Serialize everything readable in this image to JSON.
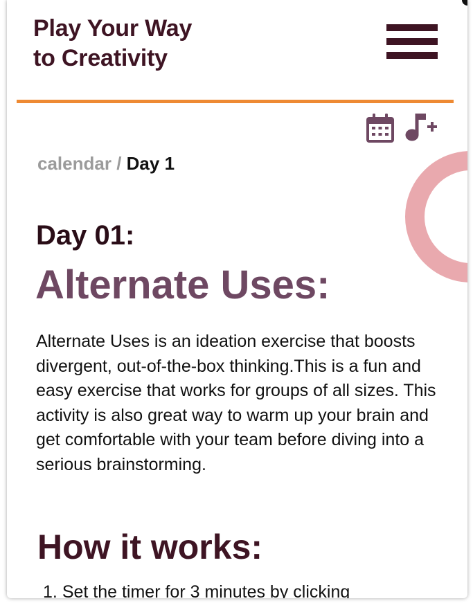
{
  "header": {
    "title_line1": "Play Your Way",
    "title_line2": "to Creativity",
    "menu_icon": "hamburger-menu-icon",
    "brand_color": "#3e1423",
    "rule_color": "#ee8a33"
  },
  "toolbar": {
    "calendar_icon": "calendar-icon",
    "music_add_icon": "music-add-icon",
    "icon_color": "#6e4862"
  },
  "breadcrumb": {
    "parent": "calendar",
    "separator": "/",
    "current": "Day 1"
  },
  "content": {
    "day_label": "Day 01:",
    "exercise_title": "Alternate Uses:",
    "description": "Alternate Uses is an ideation exercise that boosts divergent, out-of-the-box thinking.This is a fun and easy exercise that works for groups of all sizes. This activity is also great way to warm up your brain and get comfortable with your team before diving into a serious brainstorming.",
    "how_it_works_heading": "How it works:",
    "steps": [
      {
        "number": "1.",
        "text": "Set the timer for 3 minutes by clicking"
      }
    ],
    "accent_color": "#6e4862",
    "decor_color": "#e9a9ae"
  }
}
